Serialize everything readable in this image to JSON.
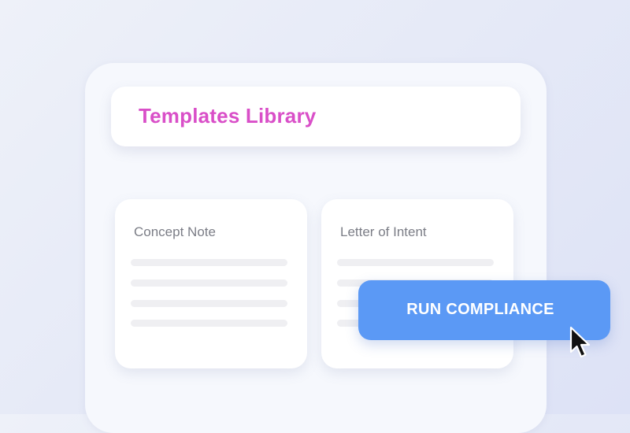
{
  "header": {
    "title": "Templates Library"
  },
  "templates": [
    {
      "title": "Concept Note"
    },
    {
      "title": "Letter of Intent"
    }
  ],
  "action": {
    "label": "RUN COMPLIANCE"
  },
  "colors": {
    "accent_title": "#d94fc8",
    "button": "#5b99f5",
    "card": "#ffffff",
    "placeholder_line": "#efeff2"
  },
  "icons": {
    "pointer": "mouse-pointer-icon"
  }
}
